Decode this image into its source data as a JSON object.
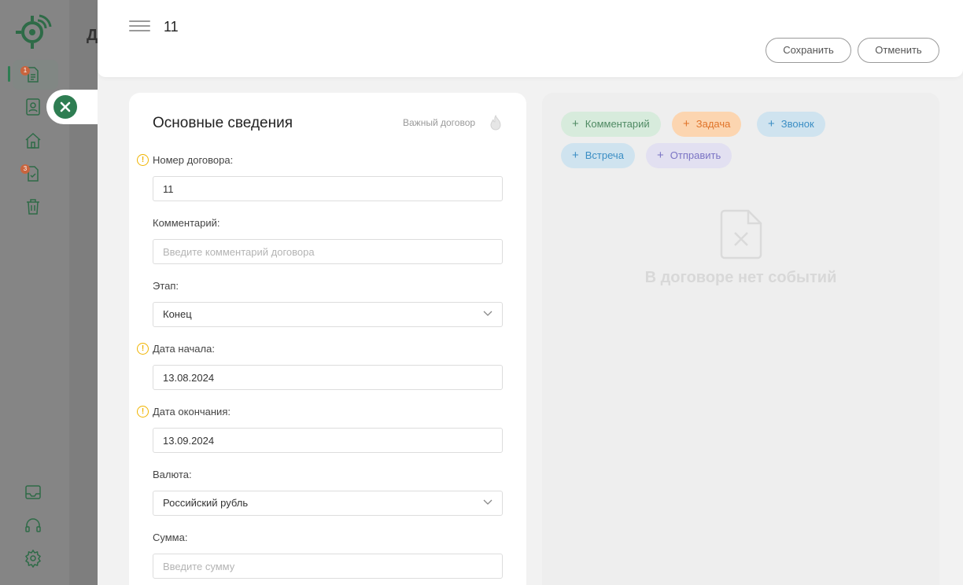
{
  "background": {
    "page_title_partial": "Д",
    "sidebar": {
      "badges": {
        "contracts": "1",
        "tasks": "3"
      }
    }
  },
  "header": {
    "doc_title": "11",
    "save_label": "Сохранить",
    "cancel_label": "Отменить"
  },
  "form": {
    "title": "Основные сведения",
    "important_label": "Важный договор",
    "contract_number": {
      "label": "Номер договора:",
      "value": "11"
    },
    "comment": {
      "label": "Комментарий:",
      "placeholder": "Введите комментарий договора"
    },
    "stage": {
      "label": "Этап:",
      "value": "Конец"
    },
    "start_date": {
      "label": "Дата начала:",
      "value": "13.08.2024"
    },
    "end_date": {
      "label": "Дата окончания:",
      "value": "13.09.2024"
    },
    "currency": {
      "label": "Валюта:",
      "value": "Российский рубль"
    },
    "amount": {
      "label": "Сумма:",
      "placeholder": "Введите сумму"
    }
  },
  "events": {
    "actions": [
      {
        "label": "Комментарий",
        "color": "#4f8a63",
        "bg": "#d7ebdc"
      },
      {
        "label": "Задача",
        "color": "#e0742a",
        "bg": "#fcd5b0"
      },
      {
        "label": "Звонок",
        "color": "#3b8ec4",
        "bg": "#cfe3ef"
      },
      {
        "label": "Встреча",
        "color": "#3b8ec4",
        "bg": "#cfe3ef"
      },
      {
        "label": "Отправить",
        "color": "#7b74c4",
        "bg": "#e2e0f1"
      }
    ],
    "empty_text": "В договоре нет событий"
  },
  "colors": {
    "accent": "#2e7d52",
    "warning": "#f0b400"
  }
}
